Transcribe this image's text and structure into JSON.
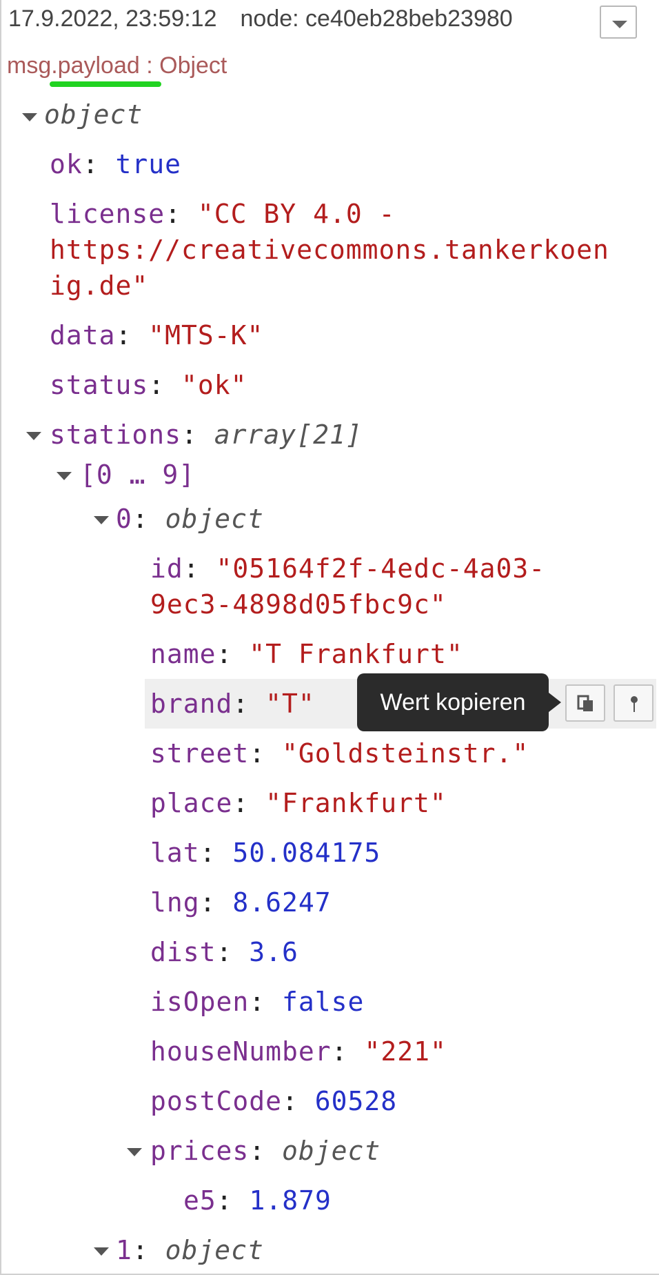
{
  "header": {
    "timestamp": "17.9.2022, 23:59:12",
    "node": "node: ce40eb28beb23980",
    "topic": "msg.payload : Object"
  },
  "tree": {
    "root_type": "object",
    "ok": {
      "key": "ok",
      "value": "true"
    },
    "license": {
      "key": "license",
      "value_line1": "\"CC BY 4.0 -",
      "value_line2": "https://creativecommons.tankerkoen",
      "value_line3": "ig.de\""
    },
    "data": {
      "key": "data",
      "value": "\"MTS-K\""
    },
    "status": {
      "key": "status",
      "value": "\"ok\""
    },
    "stations": {
      "key": "stations",
      "type": "array[21]"
    },
    "range": "[0 … 9]",
    "item0": {
      "key": "0",
      "type": "object"
    },
    "id": {
      "key": "id",
      "value_line1": "\"05164f2f-4edc-4a03-",
      "value_line2": "9ec3-4898d05fbc9c\""
    },
    "name": {
      "key": "name",
      "value": "\"T Frankfurt\""
    },
    "brand": {
      "key": "brand",
      "value": "\"T\""
    },
    "street": {
      "key": "street",
      "value": "\"Goldsteinstr.\""
    },
    "place": {
      "key": "place",
      "value": "\"Frankfurt\""
    },
    "lat": {
      "key": "lat",
      "value": "50.084175"
    },
    "lng": {
      "key": "lng",
      "value": "8.6247"
    },
    "dist": {
      "key": "dist",
      "value": "3.6"
    },
    "isOpen": {
      "key": "isOpen",
      "value": "false"
    },
    "houseNumber": {
      "key": "houseNumber",
      "value": "\"221\""
    },
    "postCode": {
      "key": "postCode",
      "value": "60528"
    },
    "prices": {
      "key": "prices",
      "type": "object"
    },
    "e5": {
      "key": "e5",
      "value": "1.879"
    },
    "item1": {
      "key": "1",
      "type": "object"
    }
  },
  "tooltip": "Wert kopieren",
  "icons": {
    "menu": "chevron-down-icon",
    "copy": "copy-icon",
    "pin": "pin-icon"
  }
}
